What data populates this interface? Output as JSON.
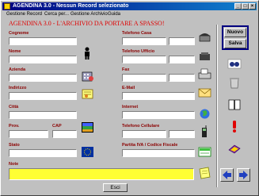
{
  "window": {
    "title": "AGENDINA 3.0 - Nessun Record selezionato",
    "minimize": "_",
    "maximize": "□",
    "close": "×"
  },
  "menu": [
    "Gestione Record",
    "Cerca per...",
    "Gestione Archivio",
    "Guida"
  ],
  "banner": "AGENDINA 3.0 - L'ARCHIVIO DA PORTARE A SPASSO!",
  "labels": {
    "cognome": "Cognome",
    "nome": "Nome",
    "azienda": "Azienda",
    "indirizzo": "Indirizzo",
    "citta": "Città",
    "prov": "Prov.",
    "cap": "CAP",
    "stato": "Stato",
    "note": "Note",
    "tel_casa": "Telefono Casa",
    "tel_ufficio": "Telefono Ufficio",
    "fax": "Fax",
    "email": "E-Mail",
    "internet": "Internet",
    "tel_cellulare": "Telefono Cellulare",
    "piva": "Partita IVA / Codice Fiscale"
  },
  "buttons": {
    "nuovo": "Nuovo",
    "salva": "Salva",
    "esci": "Esci"
  },
  "colors": {
    "label": "#8b0000",
    "banner": "#e00000",
    "note_bg": "#ffff33",
    "title_bar": "#000080"
  },
  "icons": [
    "person-icon",
    "building-icon",
    "letter-icon",
    "globe-icon",
    "flag-icon",
    "eu-flag-icon",
    "phone-icon",
    "telephone-icon",
    "fax-icon",
    "email-envelope-icon",
    "internet-globe-icon",
    "cellphone-icon",
    "invoice-icon",
    "note-pad-icon",
    "search-binoculars-icon",
    "trash-icon",
    "book-icon",
    "exclamation-icon",
    "purple-book-icon",
    "arrow-left-icon",
    "arrow-right-icon"
  ]
}
